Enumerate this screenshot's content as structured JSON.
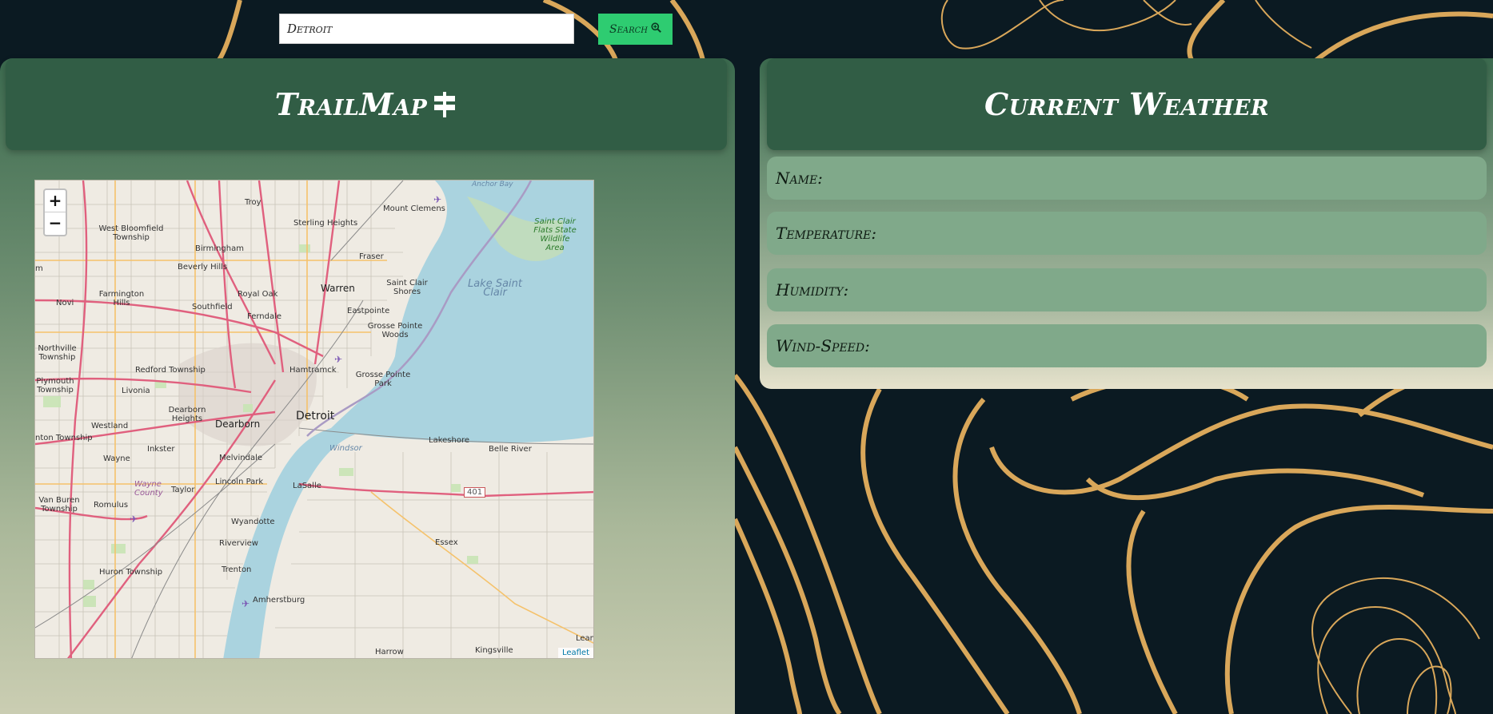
{
  "search": {
    "value": "Detroit",
    "button_label": "Search"
  },
  "trail_panel": {
    "title": "TrailMap"
  },
  "map": {
    "zoom_in": "+",
    "zoom_out": "−",
    "attribution": "Leaflet",
    "labels": {
      "troy": "Troy",
      "mount_clemens": "Mount Clemens",
      "anchor_bay": "Anchor Bay",
      "west_bloomfield": "West Bloomfield Township",
      "sterling_heights": "Sterling Heights",
      "birmingham": "Birmingham",
      "fraser": "Fraser",
      "saint_clair_flats": "Saint Clair Flats State Wildlife Area",
      "beverly_hills": "Beverly Hills",
      "farmington_hills": "Farmington Hills",
      "royal_oak": "Royal Oak",
      "warren": "Warren",
      "saint_clair_shores": "Saint Clair Shores",
      "lake_saint_clair": "Lake Saint Clair",
      "novi": "Novi",
      "southfield": "Southfield",
      "ferndale": "Ferndale",
      "eastpointe": "Eastpointe",
      "grosse_pointe_woods": "Grosse Pointe Woods",
      "northville": "Northville Township",
      "redford": "Redford Township",
      "hamtramck": "Hamtramck",
      "grosse_pointe_park": "Grosse Pointe Park",
      "plymouth": "Plymouth Township",
      "livonia": "Livonia",
      "dearborn_heights": "Dearborn Heights",
      "westland": "Westland",
      "dearborn": "Dearborn",
      "detroit": "Detroit",
      "canton": "nton Township",
      "inkster": "Inkster",
      "windsor": "Windsor",
      "lakeshore": "Lakeshore",
      "belle_river": "Belle River",
      "wayne": "Wayne",
      "melvindale": "Melvindale",
      "lincoln_park": "Lincoln Park",
      "lasalle": "LaSalle",
      "hwy_401": "401",
      "van_buren": "Van Buren Township",
      "wayne_county": "Wayne County",
      "taylor": "Taylor",
      "romulus": "Romulus",
      "wyandotte": "Wyandotte",
      "riverview": "Riverview",
      "essex": "Essex",
      "huron": "Huron Township",
      "trenton": "Trenton",
      "amherstburg": "Amherstburg",
      "harrow": "Harrow",
      "kingsville": "Kingsville",
      "leamington": "Leamington",
      "m_edge": "m"
    }
  },
  "weather_panel": {
    "title": "Current Weather",
    "name_label": "Name:",
    "temperature_label": "Temperature:",
    "humidity_label": "Humidity:",
    "wind_label": "Wind-Speed:"
  },
  "colors": {
    "background": "#0b1a22",
    "contour": "#d9a75a",
    "header_green": "#315d45",
    "row_green": "#80a98a",
    "search_button": "#2ecc71",
    "water": "#aad3df",
    "major_road": "#e0607e"
  }
}
